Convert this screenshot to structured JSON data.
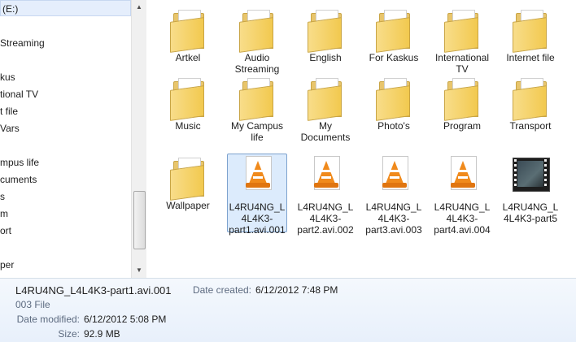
{
  "nav": {
    "drive_label": "(E:)",
    "items": [
      "Streaming",
      "kus",
      "tional TV",
      "t file",
      "Vars",
      "mpus life",
      "cuments",
      "s",
      "m",
      "ort",
      "per"
    ]
  },
  "content": {
    "items": [
      {
        "label": "Artkel",
        "kind": "folder"
      },
      {
        "label": "Audio Streaming",
        "kind": "folder"
      },
      {
        "label": "English",
        "kind": "folder"
      },
      {
        "label": "For Kaskus",
        "kind": "folder"
      },
      {
        "label": "International TV",
        "kind": "folder"
      },
      {
        "label": "Internet file",
        "kind": "folder"
      },
      {
        "label": "Music",
        "kind": "folder"
      },
      {
        "label": "My Campus life",
        "kind": "folder"
      },
      {
        "label": "My Documents",
        "kind": "folder"
      },
      {
        "label": "Photo's",
        "kind": "folder"
      },
      {
        "label": "Program",
        "kind": "folder"
      },
      {
        "label": "Transport",
        "kind": "folder"
      },
      {
        "label": "Wallpaper",
        "kind": "folder"
      },
      {
        "label": "L4RU4NG_L4L4K3-part1.avi.001",
        "kind": "vlc-file",
        "selected": true
      },
      {
        "label": "L4RU4NG_L4L4K3-part2.avi.002",
        "kind": "vlc-file"
      },
      {
        "label": "L4RU4NG_L4L4K3-part3.avi.003",
        "kind": "vlc-file"
      },
      {
        "label": "L4RU4NG_L4L4K3-part4.avi.004",
        "kind": "vlc-file"
      },
      {
        "label": "L4RU4NG_L4L4K3-part5",
        "kind": "video-file"
      }
    ]
  },
  "details": {
    "file_name": "L4RU4NG_L4L4K3-part1.avi.001",
    "file_type": "003 File",
    "date_modified_label": "Date modified:",
    "date_modified": "6/12/2012 5:08 PM",
    "size_label": "Size:",
    "size": "92.9 MB",
    "date_created_label": "Date created:",
    "date_created": "6/12/2012 7:48 PM"
  },
  "colors": {
    "folder": "#f2c94f",
    "selection": "#dcebfc",
    "vlc_cone": "#f08a1c",
    "details_bg": "#e8f0fb"
  }
}
